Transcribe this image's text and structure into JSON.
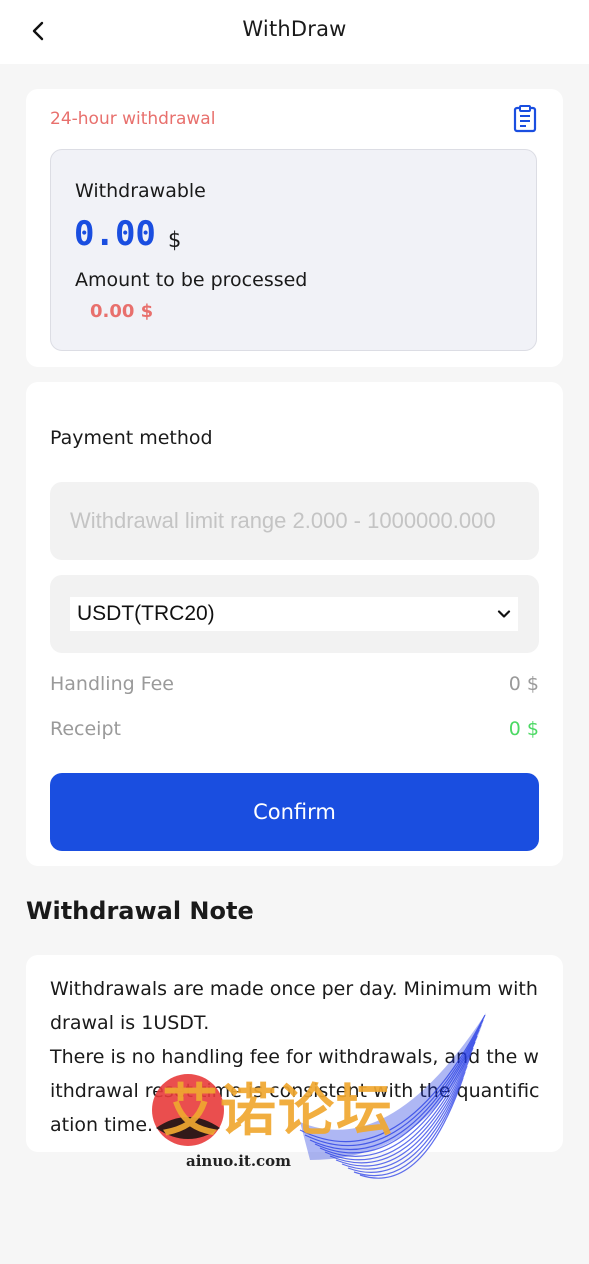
{
  "header": {
    "title": "WithDraw"
  },
  "balance": {
    "tag": "24-hour withdrawal",
    "withdrawable_label": "Withdrawable",
    "withdrawable_value": "0.00",
    "unit": "$",
    "pending_label": "Amount to be processed",
    "pending_value": "0.00 $"
  },
  "form": {
    "payment_method_label": "Payment method",
    "amount_placeholder": "Withdrawal limit range 2.000 - 1000000.000",
    "method_selected": "USDT(TRC20)",
    "fee_label": "Handling Fee",
    "fee_value": "0 $",
    "receipt_label": "Receipt",
    "receipt_value": "0 $",
    "confirm_label": "Confirm"
  },
  "note": {
    "heading": "Withdrawal Note",
    "line1": "Withdrawals are made once per day. Minimum withdrawal is 1USDT.",
    "line2": "There is no handling fee for withdrawals, and the withdrawal reset time is consistent with the quantification time."
  },
  "watermark": {
    "cn_text": "艾诺论坛",
    "domain": "ainuo.it.com"
  },
  "colors": {
    "primary": "#1a4ee0",
    "accent_red": "#e8706d",
    "success_green": "#4cd964",
    "background": "#f6f6f6"
  },
  "icons": {
    "back": "chevron-left-icon",
    "record": "clipboard-list-icon",
    "select": "chevron-down-icon"
  }
}
